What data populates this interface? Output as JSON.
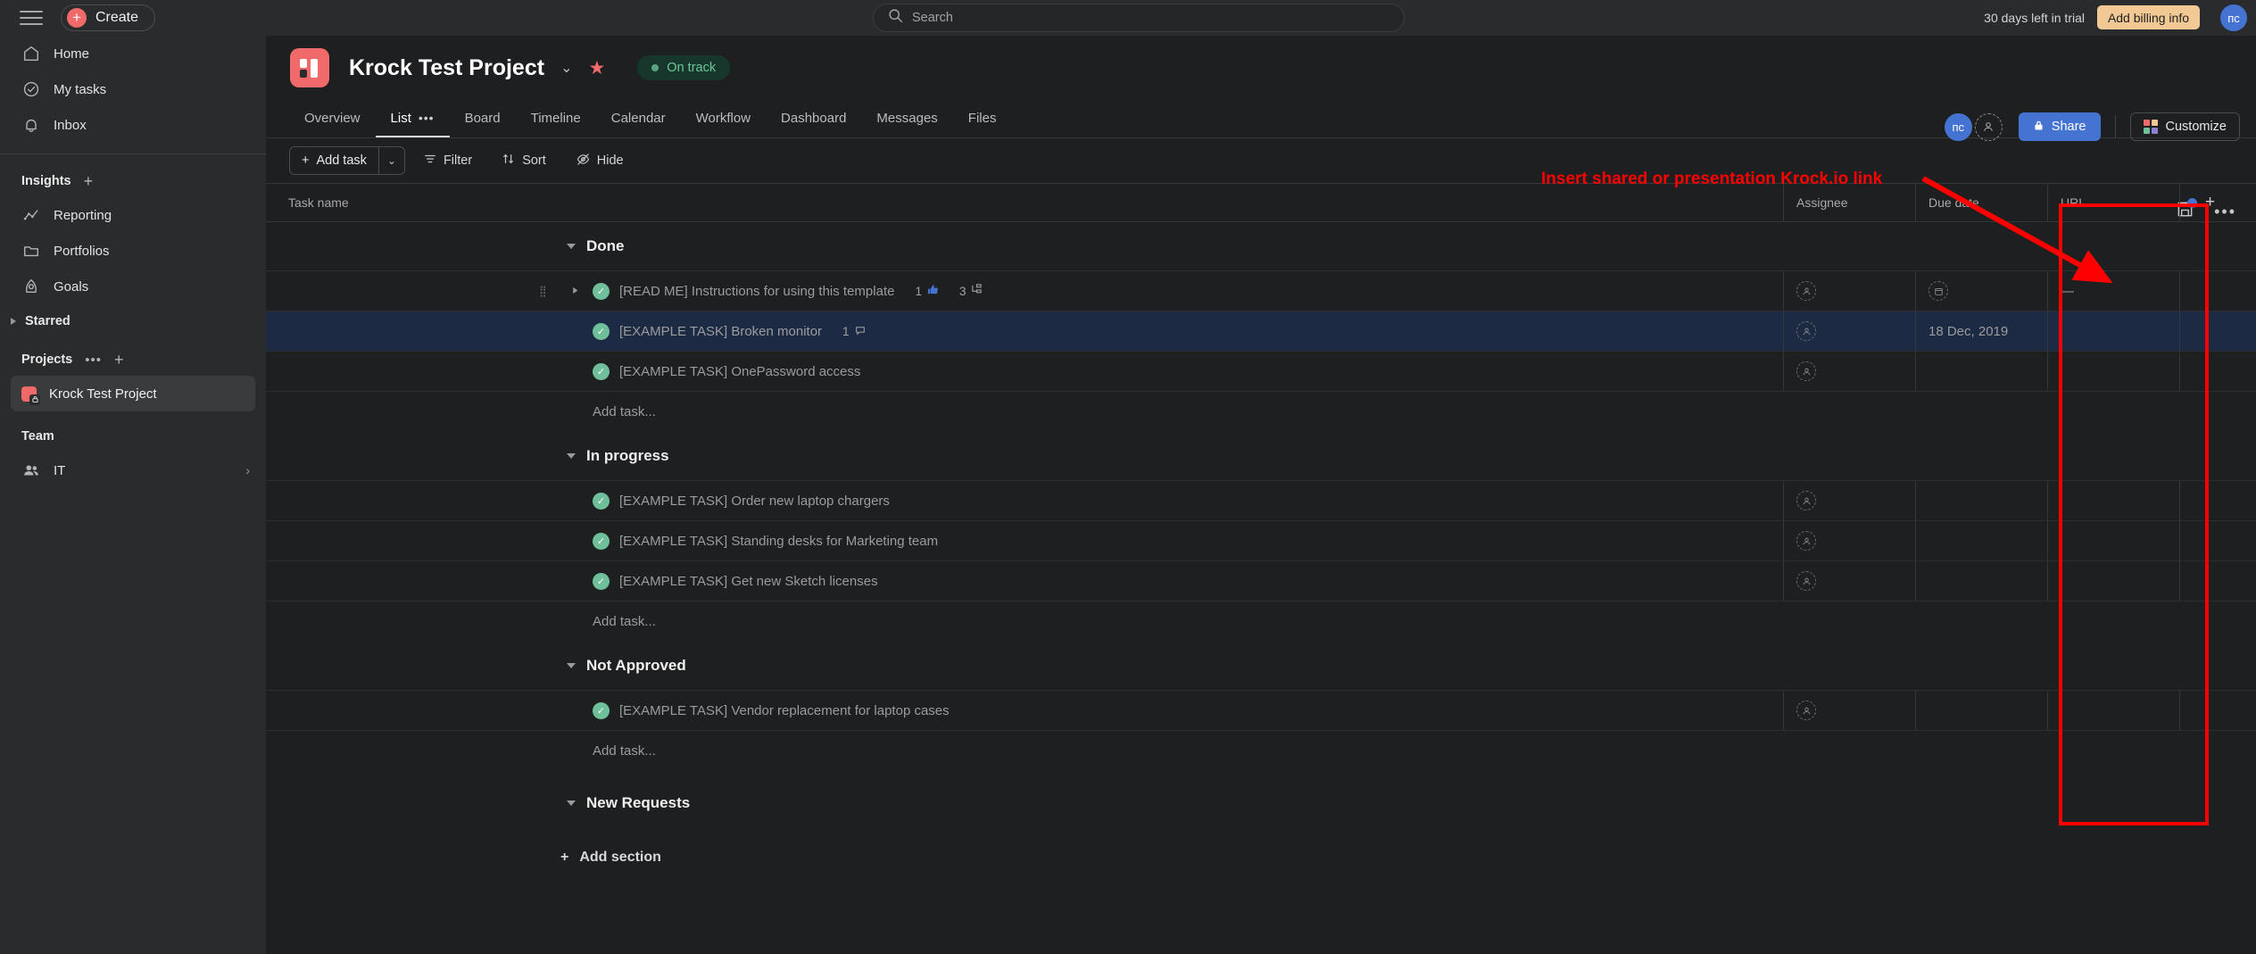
{
  "topbar": {
    "create_label": "Create",
    "search_placeholder": "Search",
    "search_value": "",
    "trial_text": "30 days left in trial",
    "billing_label": "Add billing info",
    "avatar_initials": "пс"
  },
  "sidebar": {
    "nav": [
      {
        "label": "Home",
        "icon": "home-icon"
      },
      {
        "label": "My tasks",
        "icon": "check-circle-icon"
      },
      {
        "label": "Inbox",
        "icon": "bell-icon"
      }
    ],
    "insights_label": "Insights",
    "insights": [
      {
        "label": "Reporting",
        "icon": "chart-line-icon"
      },
      {
        "label": "Portfolios",
        "icon": "folder-icon"
      },
      {
        "label": "Goals",
        "icon": "goal-icon"
      }
    ],
    "starred_label": "Starred",
    "projects_label": "Projects",
    "projects": [
      {
        "label": "Krock Test Project"
      }
    ],
    "team_label": "Team",
    "teams": [
      {
        "label": "IT"
      }
    ]
  },
  "project": {
    "title": "Krock Test Project",
    "status_label": "On track",
    "share_label": "Share",
    "customize_label": "Customize",
    "avatar_initials": "пс",
    "tabs": [
      {
        "label": "Overview",
        "active": false
      },
      {
        "label": "List",
        "active": true
      },
      {
        "label": "Board",
        "active": false
      },
      {
        "label": "Timeline",
        "active": false
      },
      {
        "label": "Calendar",
        "active": false
      },
      {
        "label": "Workflow",
        "active": false
      },
      {
        "label": "Dashboard",
        "active": false
      },
      {
        "label": "Messages",
        "active": false
      },
      {
        "label": "Files",
        "active": false
      }
    ]
  },
  "toolbar": {
    "add_task_label": "Add task",
    "filter_label": "Filter",
    "sort_label": "Sort",
    "hide_label": "Hide"
  },
  "table": {
    "columns": {
      "name": "Task name",
      "assignee": "Assignee",
      "due_date": "Due date",
      "url": "URL",
      "add": "+"
    },
    "add_task_placeholder": "Add task...",
    "add_section_label": "Add section",
    "sections": [
      {
        "title": "Done",
        "tasks": [
          {
            "name": "[READ ME] Instructions for using this template",
            "likes": "1",
            "subtasks": "3",
            "due": "",
            "url": "—",
            "selected": false,
            "expandable": true,
            "has_assignee_placeholder": true,
            "has_due_placeholder": true
          },
          {
            "name": "[EXAMPLE TASK] Broken monitor",
            "comments": "1",
            "due": "18 Dec, 2019",
            "url": "",
            "selected": true,
            "expandable": false,
            "has_assignee_placeholder": true,
            "has_due_placeholder": false
          },
          {
            "name": "[EXAMPLE TASK] OnePassword access",
            "due": "",
            "url": "",
            "selected": false,
            "expandable": false,
            "has_assignee_placeholder": true,
            "has_due_placeholder": false
          }
        ]
      },
      {
        "title": "In progress",
        "tasks": [
          {
            "name": "[EXAMPLE TASK] Order new laptop chargers",
            "due": "",
            "url": "",
            "selected": false,
            "expandable": false,
            "has_assignee_placeholder": true,
            "has_due_placeholder": false
          },
          {
            "name": "[EXAMPLE TASK] Standing desks for Marketing team",
            "due": "",
            "url": "",
            "selected": false,
            "expandable": false,
            "has_assignee_placeholder": true,
            "has_due_placeholder": false
          },
          {
            "name": "[EXAMPLE TASK] Get new Sketch licenses",
            "due": "",
            "url": "",
            "selected": false,
            "expandable": false,
            "has_assignee_placeholder": true,
            "has_due_placeholder": false
          }
        ]
      },
      {
        "title": "Not Approved",
        "tasks": [
          {
            "name": "[EXAMPLE TASK] Vendor replacement for laptop cases",
            "due": "",
            "url": "",
            "selected": false,
            "expandable": false,
            "has_assignee_placeholder": true,
            "has_due_placeholder": false
          }
        ]
      },
      {
        "title": "New Requests",
        "tasks": []
      }
    ]
  },
  "annotation": {
    "text": "Insert shared or presentation Krock.io link",
    "color": "#ff0000"
  },
  "colors": {
    "accent_red": "#f06a6a",
    "accent_blue": "#4573d2",
    "status_green": "#6ec69a",
    "billing_amber": "#f2c994",
    "annotation_red": "#ff0000",
    "selected_row": "#1c2a44"
  }
}
